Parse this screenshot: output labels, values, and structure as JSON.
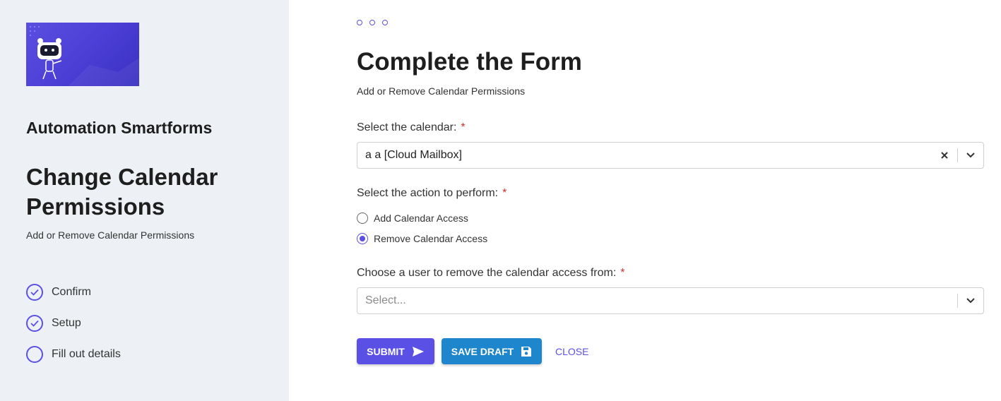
{
  "sidebar": {
    "app_name": "Automation Smartforms",
    "title": "Change Calendar Permissions",
    "subtitle": "Add or Remove Calendar Permissions",
    "steps": [
      {
        "label": "Confirm",
        "status": "complete"
      },
      {
        "label": "Setup",
        "status": "complete"
      },
      {
        "label": "Fill out details",
        "status": "current"
      }
    ]
  },
  "form": {
    "title": "Complete the Form",
    "subtitle": "Add or Remove Calendar Permissions",
    "calendar_label": "Select the calendar:",
    "calendar_value": "a a [Cloud Mailbox]",
    "action_label": "Select the action to perform:",
    "actions": [
      {
        "label": "Add Calendar Access",
        "checked": false
      },
      {
        "label": "Remove Calendar Access",
        "checked": true
      }
    ],
    "user_label": "Choose a user to remove the calendar access from:",
    "user_placeholder": "Select...",
    "required_marker": "*"
  },
  "buttons": {
    "submit": "SUBMIT",
    "save_draft": "SAVE DRAFT",
    "close": "CLOSE"
  },
  "colors": {
    "accent": "#5b50e6",
    "draft": "#1e86cc",
    "sidebar_bg": "#edf1f5",
    "required": "#d32f2f"
  }
}
